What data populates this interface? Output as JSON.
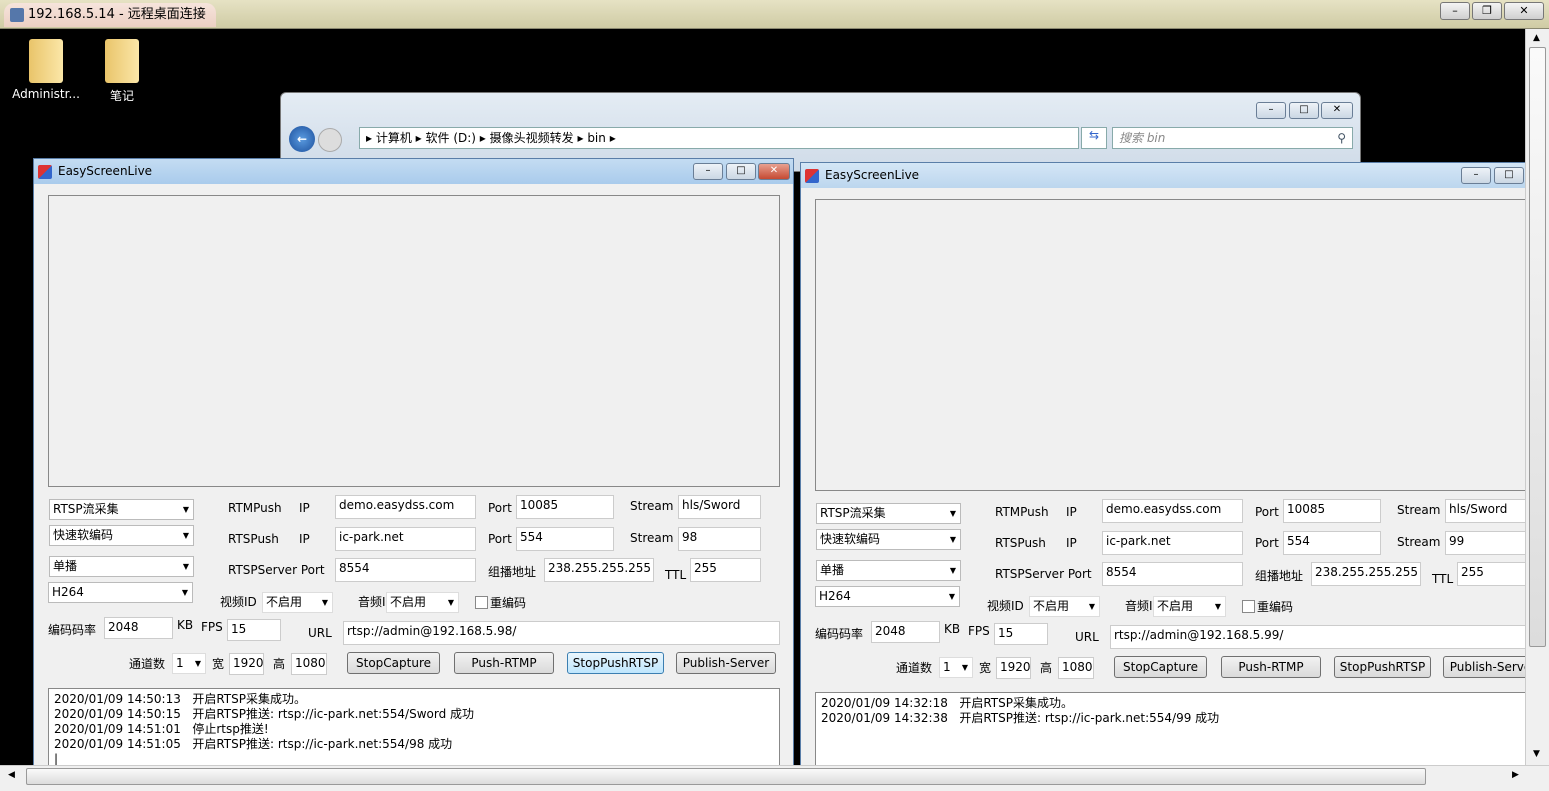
{
  "rdp": {
    "title": "192.168.5.14 - 远程桌面连接",
    "buttons": [
      "minimize",
      "restore",
      "close"
    ]
  },
  "desktop": {
    "icons": [
      {
        "label": "Administr...",
        "icon": "user-folder-icon"
      },
      {
        "label": "笔记",
        "icon": "folder-icon"
      }
    ]
  },
  "explorer": {
    "back_icon": "back-arrow-icon",
    "breadcrumb": [
      "计算机",
      "软件 (D:)",
      "摄像头视频转发",
      "bin"
    ],
    "search_placeholder": "搜索 bin"
  },
  "windows": [
    {
      "title": "EasyScreenLive",
      "source": "RTSP流采集",
      "encoder": "快速软编码",
      "cast": "单播",
      "codec": "H264",
      "rtmp": {
        "label": "RTMPush",
        "ip_label": "IP",
        "ip": "demo.easydss.com",
        "port_label": "Port",
        "port": "10085",
        "stream_label": "Stream",
        "stream": "hls/Sword"
      },
      "rtsp": {
        "label": "RTSPush",
        "ip_label": "IP",
        "ip": "ic-park.net",
        "port_label": "Port",
        "port": "554",
        "stream_label": "Stream",
        "stream": "98"
      },
      "server": {
        "label": "RTSPServer Port",
        "port": "8554",
        "mc_label": "组播地址",
        "mc": "238.255.255.255",
        "ttl_label": "TTL",
        "ttl": "255"
      },
      "vid_label": "视频ID",
      "vid": "不启用",
      "aud_label": "音频ID",
      "aud": "不启用",
      "reencode_label": "重编码",
      "reencode": false,
      "bitrate_label": "编码码率",
      "bitrate": "2048",
      "kb": "KB",
      "fps_label": "FPS",
      "fps": "15",
      "url_label": "URL",
      "url": "rtsp://admin@192.168.5.98/",
      "ch_label": "通道数",
      "ch": "1",
      "w_label": "宽",
      "w": "1920",
      "h_label": "高",
      "h": "1080",
      "btns": [
        "StopCapture",
        "Push-RTMP",
        "StopPushRTSP",
        "Publish-Server"
      ],
      "log": "2020/01/09 14:50:13   开启RTSP采集成功。\n2020/01/09 14:50:15   开启RTSP推送: rtsp://ic-park.net:554/Sword 成功\n2020/01/09 14:51:01   停止rtsp推送!\n2020/01/09 14:51:05   开启RTSP推送: rtsp://ic-park.net:554/98 成功\n|"
    },
    {
      "title": "EasyScreenLive",
      "source": "RTSP流采集",
      "encoder": "快速软编码",
      "cast": "单播",
      "codec": "H264",
      "rtmp": {
        "label": "RTMPush",
        "ip_label": "IP",
        "ip": "demo.easydss.com",
        "port_label": "Port",
        "port": "10085",
        "stream_label": "Stream",
        "stream": "hls/Sword"
      },
      "rtsp": {
        "label": "RTSPush",
        "ip_label": "IP",
        "ip": "ic-park.net",
        "port_label": "Port",
        "port": "554",
        "stream_label": "Stream",
        "stream": "99"
      },
      "server": {
        "label": "RTSPServer Port",
        "port": "8554",
        "mc_label": "组播地址",
        "mc": "238.255.255.255",
        "ttl_label": "TTL",
        "ttl": "255"
      },
      "vid_label": "视频ID",
      "vid": "不启用",
      "aud_label": "音频ID",
      "aud": "不启用",
      "reencode_label": "重编码",
      "reencode": false,
      "bitrate_label": "编码码率",
      "bitrate": "2048",
      "kb": "KB",
      "fps_label": "FPS",
      "fps": "15",
      "url_label": "URL",
      "url": "rtsp://admin@192.168.5.99/",
      "ch_label": "通道数",
      "ch": "1",
      "w_label": "宽",
      "w": "1920",
      "h_label": "高",
      "h": "1080",
      "btns": [
        "StopCapture",
        "Push-RTMP",
        "StopPushRTSP",
        "Publish-Server"
      ],
      "log": "2020/01/09 14:32:18   开启RTSP采集成功。\n2020/01/09 14:32:38   开启RTSP推送: rtsp://ic-park.net:554/99 成功"
    }
  ]
}
